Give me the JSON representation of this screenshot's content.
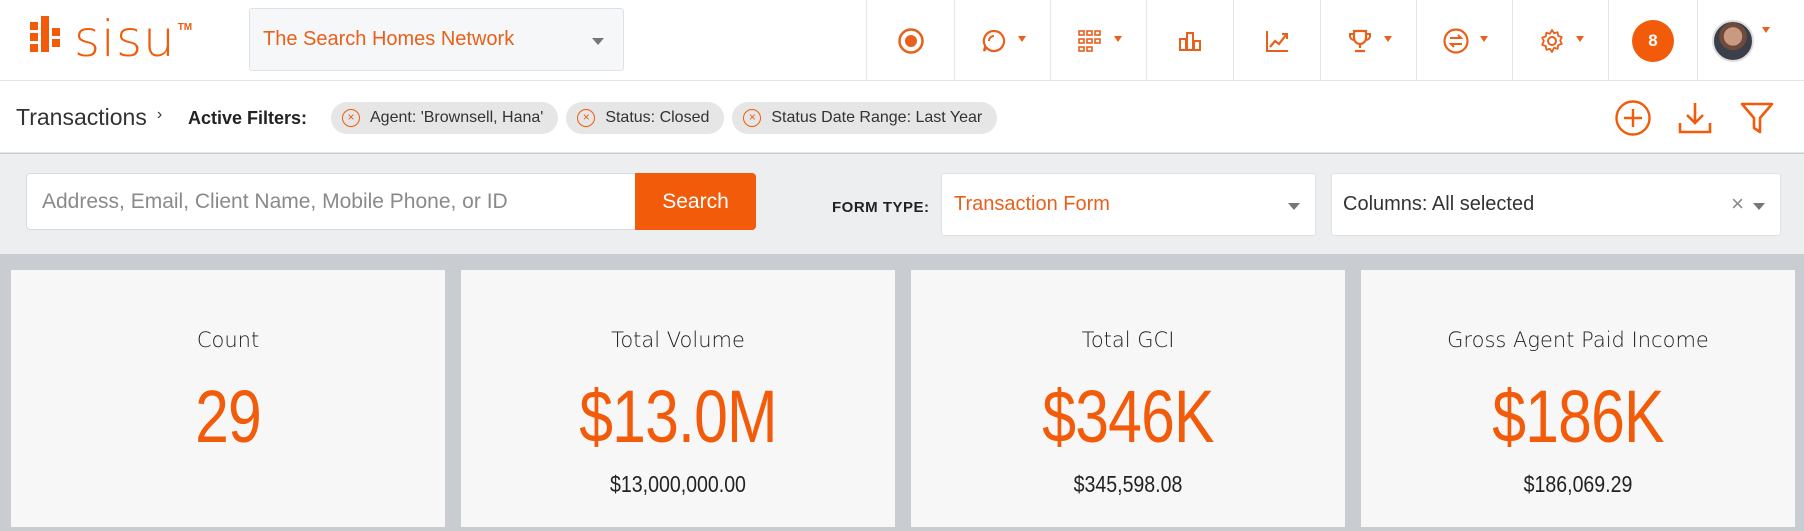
{
  "app": {
    "logo_text": "sisu",
    "logo_tm": "TM"
  },
  "team_selector": {
    "value": "The Search Homes Network"
  },
  "nav": {
    "items": [
      {
        "icon": "target-icon"
      },
      {
        "icon": "chat-icon"
      },
      {
        "icon": "grid-icon"
      },
      {
        "icon": "bar-chart-icon"
      },
      {
        "icon": "trend-icon"
      },
      {
        "icon": "trophy-icon"
      },
      {
        "icon": "transfer-icon"
      },
      {
        "icon": "gear-icon"
      }
    ],
    "notifications_count": "8"
  },
  "filters": {
    "breadcrumb": "Transactions",
    "active_label": "Active Filters:",
    "chips": [
      "Agent: 'Brownsell, Hana'",
      "Status: Closed",
      "Status Date Range: Last Year"
    ]
  },
  "search": {
    "placeholder": "Address, Email, Client Name, Mobile Phone, or ID",
    "button_label": "Search",
    "form_type_label": "FORM TYPE:",
    "form_type_value": "Transaction Form",
    "columns_value": "Columns: All selected"
  },
  "stats": [
    {
      "title": "Count",
      "big": "29",
      "small": ""
    },
    {
      "title": "Total Volume",
      "big": "$13.0M",
      "small": "$13,000,000.00"
    },
    {
      "title": "Total GCI",
      "big": "$346K",
      "small": "$345,598.08"
    },
    {
      "title": "Gross Agent Paid Income",
      "big": "$186K",
      "small": "$186,069.29"
    }
  ],
  "colors": {
    "accent": "#f25b0a"
  }
}
